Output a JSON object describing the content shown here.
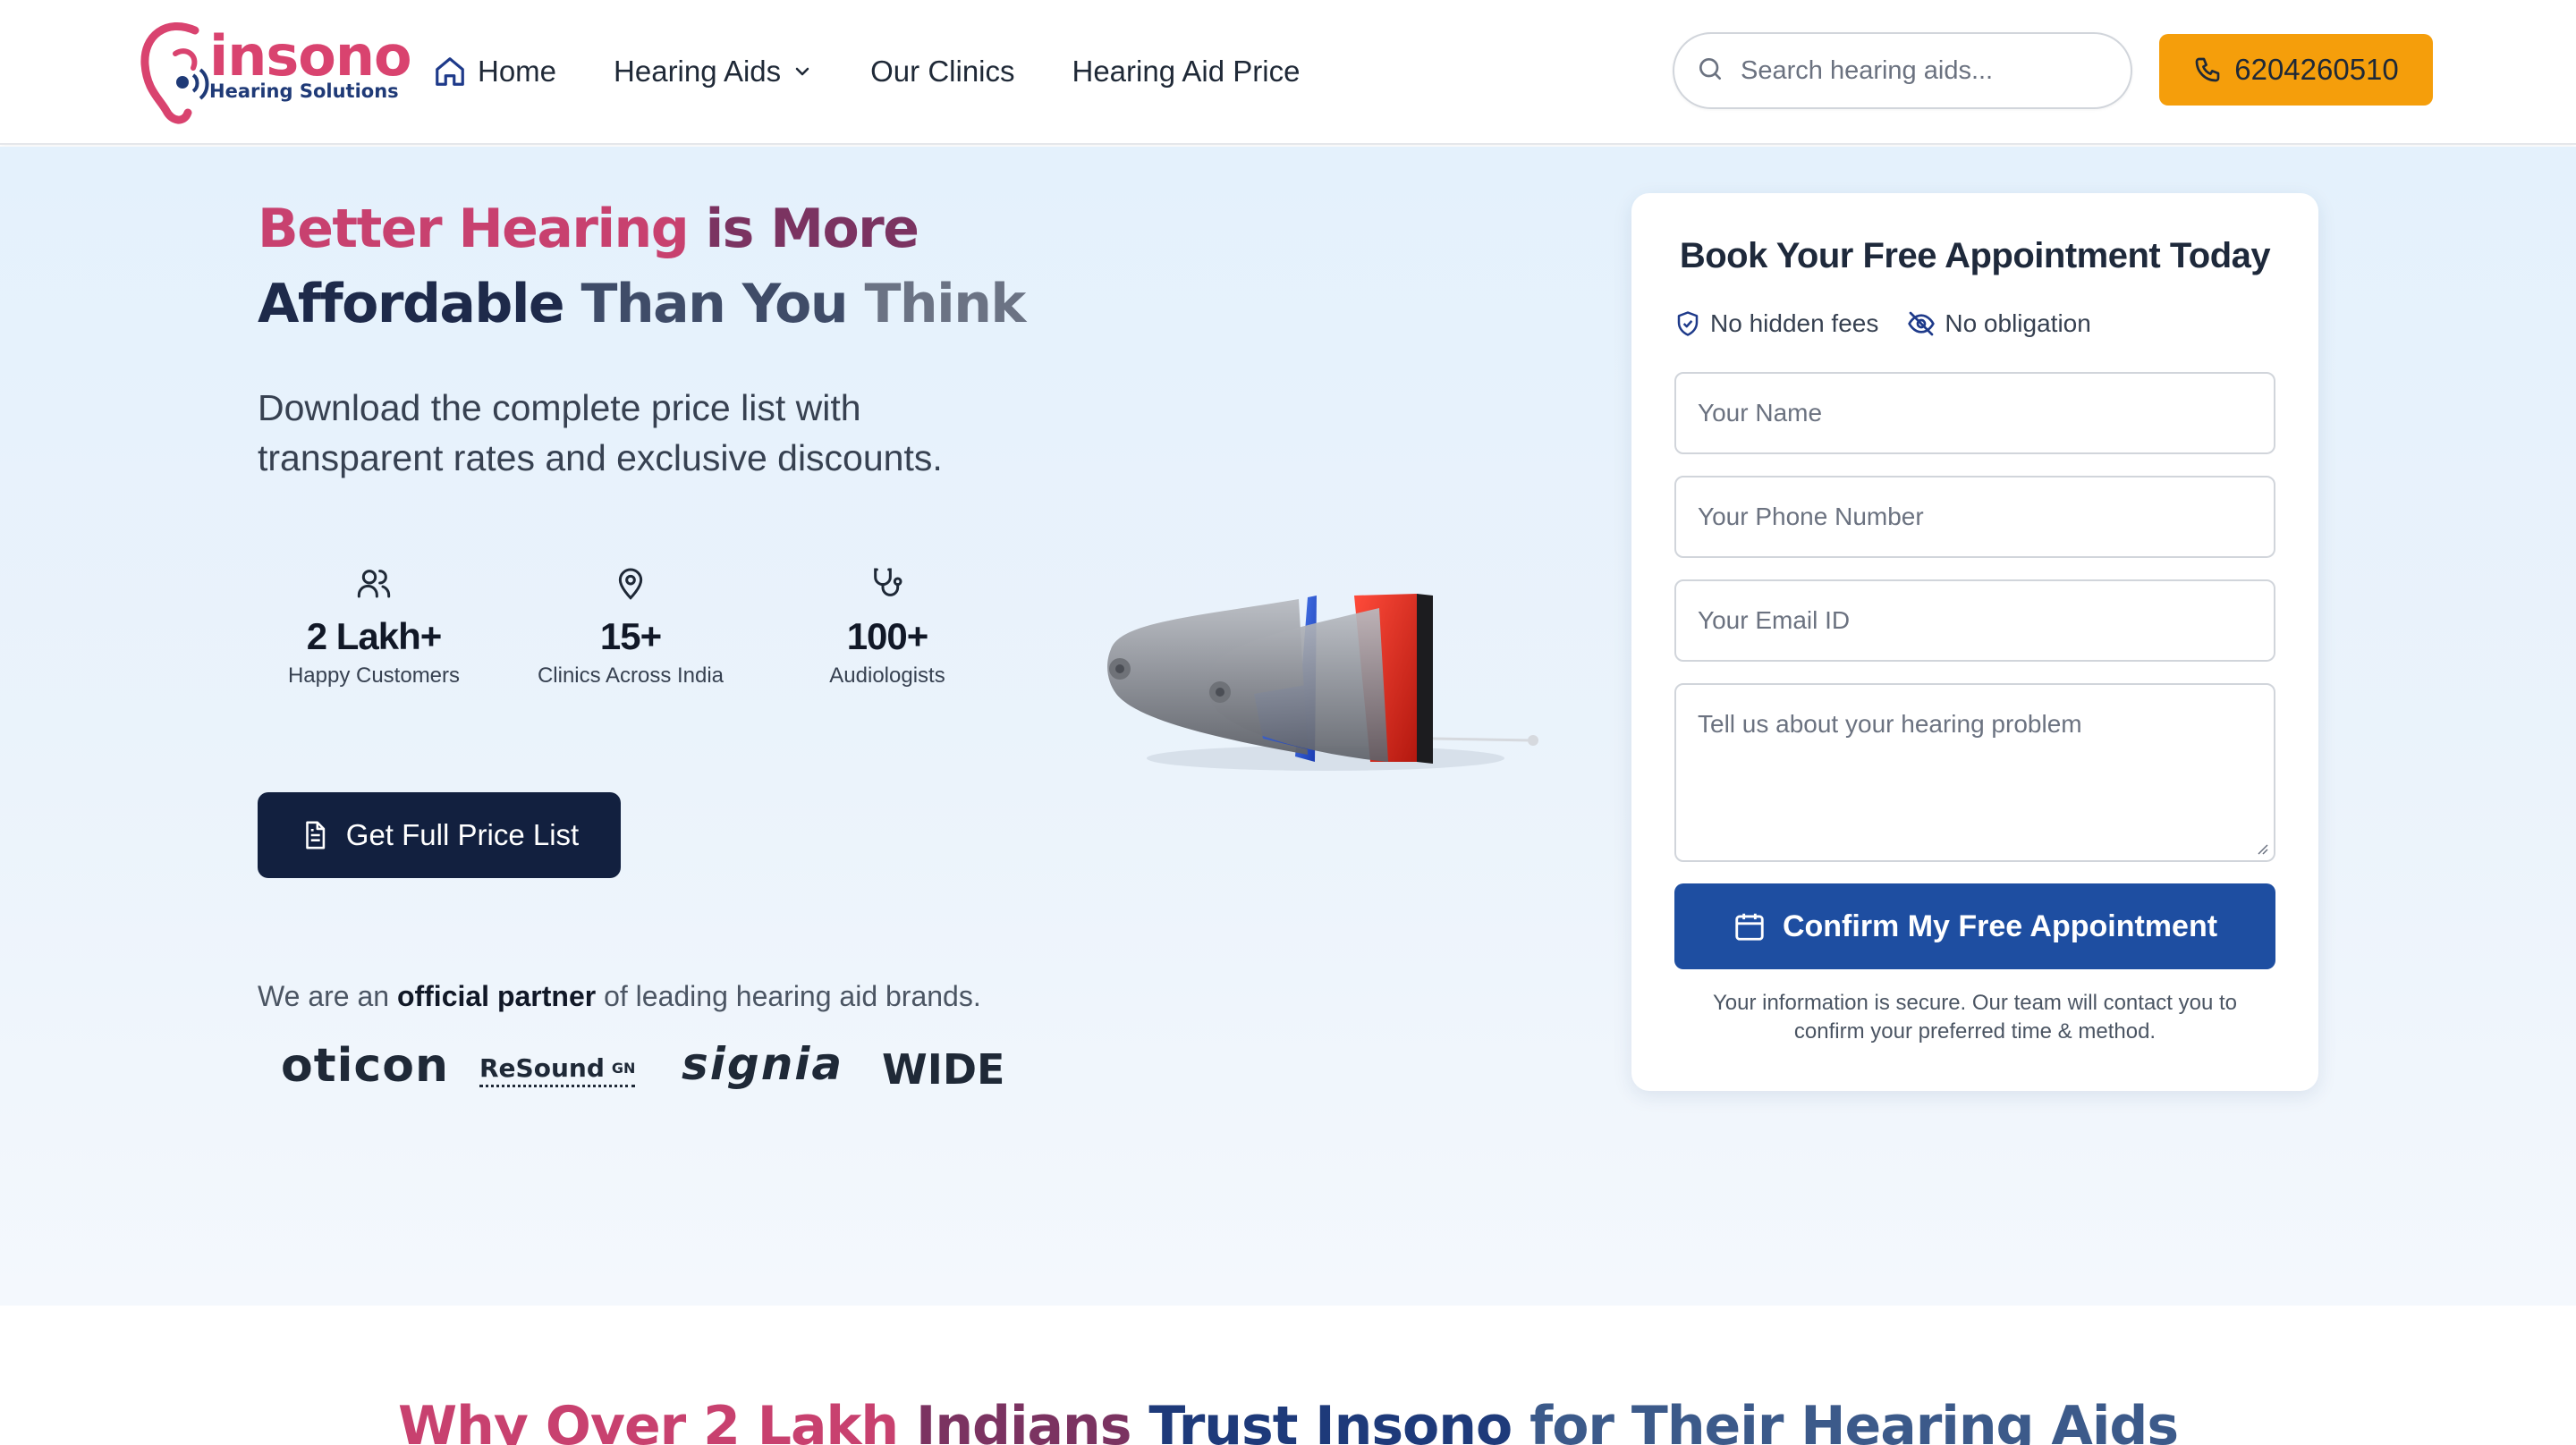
{
  "header": {
    "logo_text": "insono",
    "logo_sub": "Hearing Solutions",
    "nav": [
      {
        "label": "Home",
        "icon": "home-icon"
      },
      {
        "label": "Hearing Aids",
        "icon": "chevron-down-icon"
      },
      {
        "label": "Our Clinics"
      },
      {
        "label": "Hearing Aid Price"
      }
    ],
    "search_placeholder": "Search hearing aids...",
    "phone": "6204260510"
  },
  "hero": {
    "headline": {
      "part1": "Better Hearing",
      "part2": "is More",
      "part3": "Affordable",
      "part4": "Than You",
      "part5": "Think"
    },
    "subtext": "Download the complete price list with transparent rates and exclusive discounts.",
    "stats": [
      {
        "value": "2 Lakh+",
        "label": "Happy Customers",
        "icon": "users-icon"
      },
      {
        "value": "15+",
        "label": "Clinics Across India",
        "icon": "map-pin-icon"
      },
      {
        "value": "100+",
        "label": "Audiologists",
        "icon": "stethoscope-icon"
      }
    ],
    "cta_label": "Get Full Price List",
    "partner": {
      "prefix": "We are an",
      "bold": "official partner",
      "suffix": "of leading hearing aid brands."
    },
    "brands": {
      "oticon": "oticon",
      "resound": "ReSound",
      "resound_gn": "GN",
      "signia": "signia",
      "widex": "WIDEX"
    }
  },
  "form": {
    "title": "Book Your Free Appointment Today",
    "badge1": "No hidden fees",
    "badge2": "No obligation",
    "name_placeholder": "Your Name",
    "phone_placeholder": "Your Phone Number",
    "email_placeholder": "Your Email ID",
    "problem_placeholder": "Tell us about your hearing problem",
    "submit_label": "Confirm My Free Appointment",
    "note": "Your information is secure. Our team will contact you to confirm your preferred time & method."
  },
  "why": {
    "part1": "Why Over 2 Lakh",
    "part2": "Indians",
    "part3": "Trust Insono",
    "part4": "for Their Hearing Aids"
  },
  "colors": {
    "brand_pink": "#d9436f",
    "navy": "#12203f",
    "accent_orange": "#f59e0b",
    "primary_blue": "#1e4ea1"
  }
}
